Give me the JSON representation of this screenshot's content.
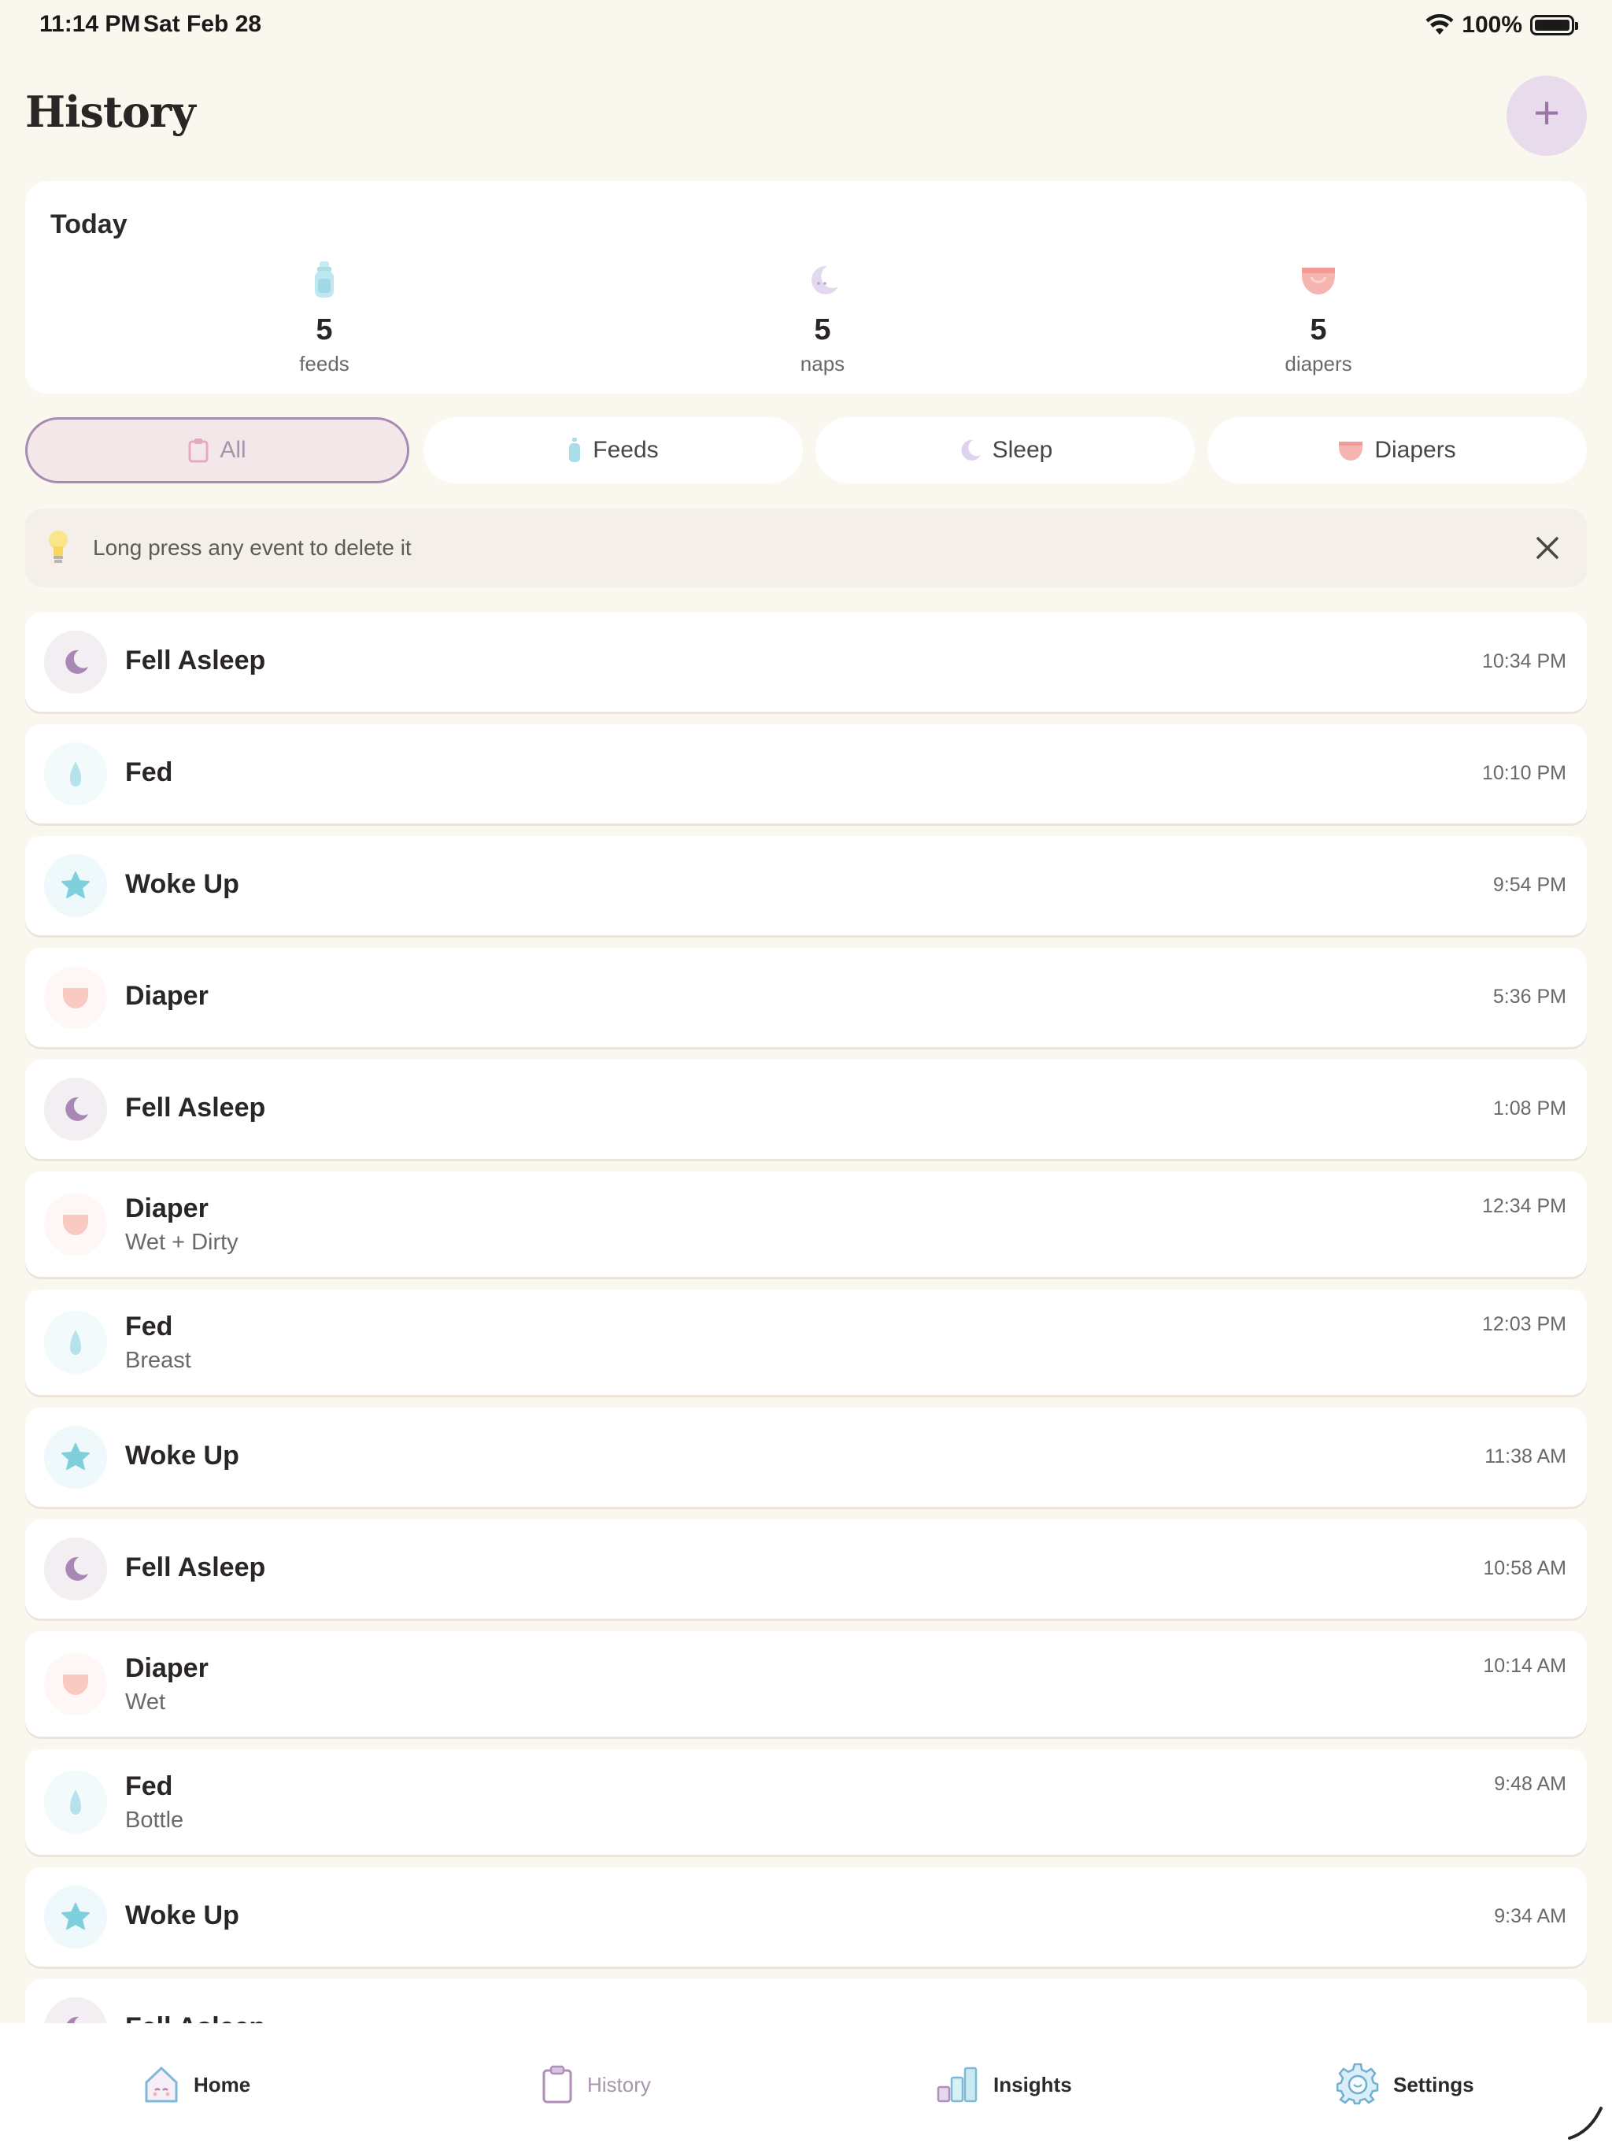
{
  "status_bar": {
    "time": "11:14 PM",
    "date": "Sat Feb 28",
    "battery": "100%"
  },
  "header": {
    "title": "History",
    "add_label": "+"
  },
  "summary": {
    "title": "Today",
    "stats": [
      {
        "icon": "bottle-icon",
        "value": "5",
        "label": "feeds"
      },
      {
        "icon": "moon-icon",
        "value": "5",
        "label": "naps"
      },
      {
        "icon": "diaper-icon",
        "value": "5",
        "label": "diapers"
      }
    ]
  },
  "filters": [
    {
      "label": "All",
      "icon": "clipboard-icon",
      "active": true
    },
    {
      "label": "Feeds",
      "icon": "bottle-icon",
      "active": false
    },
    {
      "label": "Sleep",
      "icon": "moon-icon",
      "active": false
    },
    {
      "label": "Diapers",
      "icon": "diaper-icon",
      "active": false
    }
  ],
  "tip": {
    "text": "Long press any event to delete it"
  },
  "events": [
    {
      "type": "sleep",
      "title": "Fell Asleep",
      "subtitle": "",
      "time": "10:34 PM"
    },
    {
      "type": "feed",
      "title": "Fed",
      "subtitle": "",
      "time": "10:10 PM"
    },
    {
      "type": "wake",
      "title": "Woke Up",
      "subtitle": "",
      "time": "9:54 PM"
    },
    {
      "type": "diaper",
      "title": "Diaper",
      "subtitle": "",
      "time": "5:36 PM"
    },
    {
      "type": "sleep",
      "title": "Fell Asleep",
      "subtitle": "",
      "time": "1:08 PM"
    },
    {
      "type": "diaper",
      "title": "Diaper",
      "subtitle": "Wet + Dirty",
      "time": "12:34 PM"
    },
    {
      "type": "feed",
      "title": "Fed",
      "subtitle": "Breast",
      "time": "12:03 PM"
    },
    {
      "type": "wake",
      "title": "Woke Up",
      "subtitle": "",
      "time": "11:38 AM"
    },
    {
      "type": "sleep",
      "title": "Fell Asleep",
      "subtitle": "",
      "time": "10:58 AM"
    },
    {
      "type": "diaper",
      "title": "Diaper",
      "subtitle": "Wet",
      "time": "10:14 AM"
    },
    {
      "type": "feed",
      "title": "Fed",
      "subtitle": "Bottle",
      "time": "9:48 AM"
    },
    {
      "type": "wake",
      "title": "Woke Up",
      "subtitle": "",
      "time": "9:34 AM"
    },
    {
      "type": "sleep",
      "title": "Fell Asleep",
      "subtitle": "",
      "time": ""
    }
  ],
  "nav": [
    {
      "label": "Home",
      "icon": "house-icon",
      "active": false
    },
    {
      "label": "History",
      "icon": "clipboard-icon",
      "active": true
    },
    {
      "label": "Insights",
      "icon": "bar-chart-icon",
      "active": false
    },
    {
      "label": "Settings",
      "icon": "gear-icon",
      "active": false
    }
  ],
  "colors": {
    "background": "#FAF7EF",
    "accent_purple": "#A894AD",
    "sleep": "#A887B4",
    "feed": "#A9DDE8",
    "wake": "#7FD0DC",
    "diaper": "#F6B5B0"
  }
}
